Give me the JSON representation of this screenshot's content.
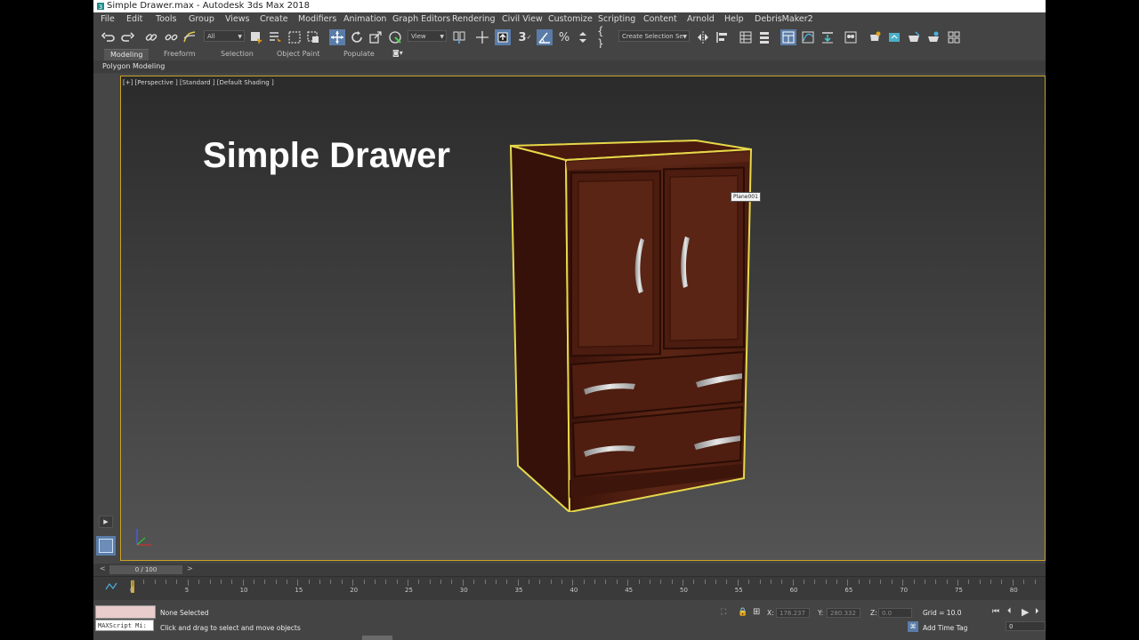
{
  "window": {
    "title": "Simple Drawer.max - Autodesk 3ds Max 2018"
  },
  "menu": [
    "File",
    "Edit",
    "Tools",
    "Group",
    "Views",
    "Create",
    "Modifiers",
    "Animation",
    "Graph Editors",
    "Rendering",
    "Civil View",
    "Customize",
    "Scripting",
    "Content",
    "Arnold",
    "Help",
    "DebrisMaker2"
  ],
  "toolbar": {
    "filter_dropdown": "All",
    "view_dropdown": "View",
    "snap_label": "3",
    "selection_set_placeholder": "Create Selection Se"
  },
  "ribbon": {
    "tabs": [
      "Modeling",
      "Freeform",
      "Selection",
      "Object Paint",
      "Populate"
    ],
    "active_tab": "Modeling",
    "panel_label": "Polygon Modeling"
  },
  "viewport": {
    "label": "[+] [Perspective ] [Standard ] [Default Shading ]",
    "heading": "Simple Drawer",
    "object_tag": "Plane001"
  },
  "timeline": {
    "slider": "0 / 100",
    "prev": "<",
    "next": ">",
    "ticks": [
      "0",
      "5",
      "10",
      "15",
      "20",
      "25",
      "30",
      "35",
      "40",
      "45",
      "50",
      "55",
      "60",
      "65",
      "70",
      "75",
      "80"
    ]
  },
  "status": {
    "maxscript": "MAXScript Mi:",
    "selection": "None Selected",
    "prompt": "Click and drag to select and move objects",
    "x_label": "X:",
    "x_value": "178.237",
    "y_label": "Y:",
    "y_value": "280.332",
    "z_label": "Z:",
    "z_value": "0.0",
    "grid": "Grid = 10.0",
    "time_tag": "Add Time Tag",
    "frame": "0"
  },
  "colors": {
    "selection_outline": "#e6d84a",
    "wood": "#4a1c10",
    "viewport_border": "#c9a227",
    "active_tool": "#5a7ca8"
  }
}
